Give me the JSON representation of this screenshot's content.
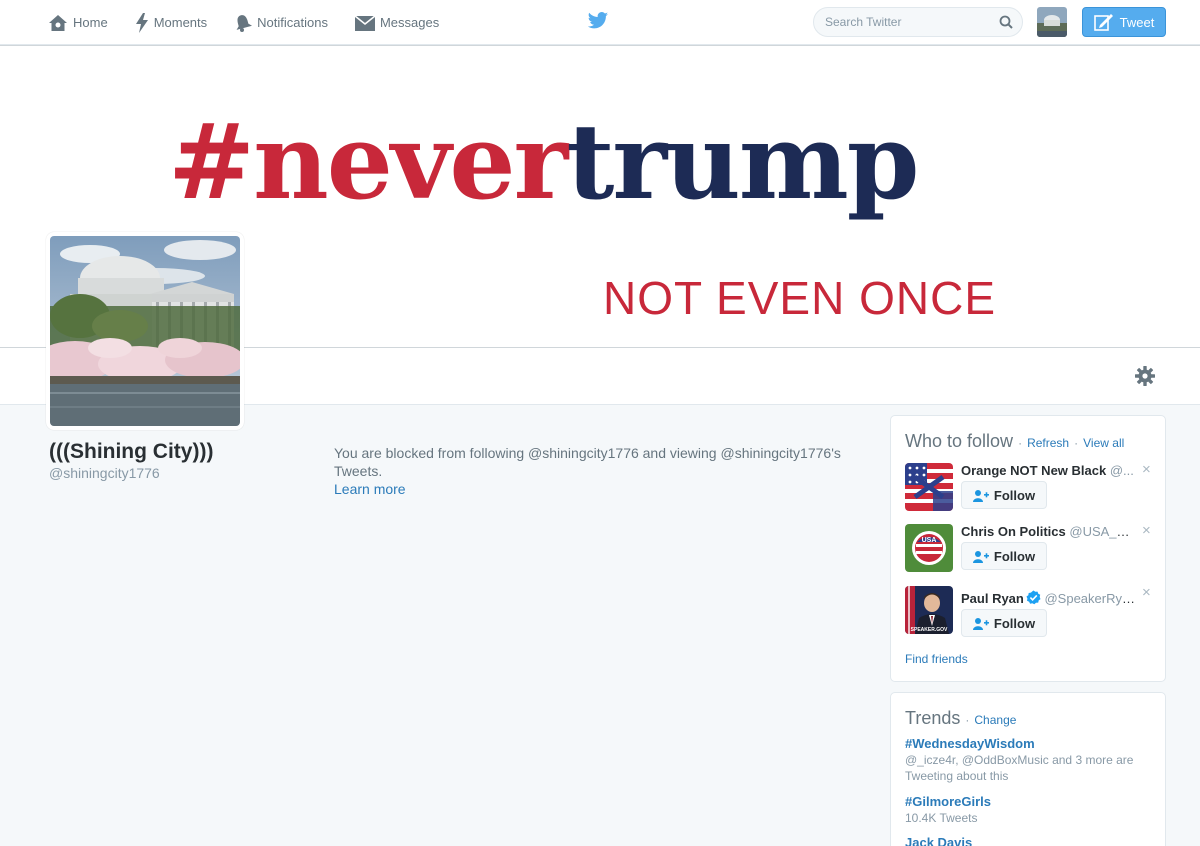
{
  "nav": {
    "items": [
      {
        "label": "Home",
        "icon": "home-icon"
      },
      {
        "label": "Moments",
        "icon": "lightning-icon"
      },
      {
        "label": "Notifications",
        "icon": "bell-icon"
      },
      {
        "label": "Messages",
        "icon": "envelope-icon"
      }
    ],
    "search_placeholder": "Search Twitter",
    "tweet_label": "Tweet"
  },
  "banner": {
    "hash": "#",
    "never": "never",
    "trump": "trump",
    "tagline": "NOT EVEN ONCE"
  },
  "profile": {
    "name": "(((Shining City)))",
    "handle": "@shiningcity1776",
    "blocked_text": "You are blocked from following @shiningcity1776 and viewing @shiningcity1776's Tweets.",
    "learn_more": "Learn more"
  },
  "who_to_follow": {
    "title": "Who to follow",
    "refresh": "Refresh",
    "view_all": "View all",
    "separator": "·",
    "follow_label": "Follow",
    "dismiss": "×",
    "suggestions": [
      {
        "name": "Orange NOT New Black",
        "handle": "@..."
      },
      {
        "name": "Chris On Politics",
        "handle": "@USA_Fi..."
      },
      {
        "name": "Paul Ryan",
        "handle": "@SpeakerRyan",
        "verified": true,
        "photo_caption": "SPEAKER.GOV"
      }
    ],
    "find_friends": "Find friends"
  },
  "trends": {
    "title": "Trends",
    "change": "Change",
    "separator": "·",
    "items": [
      {
        "name": "#WednesdayWisdom",
        "desc": "@_icze4r, @OddBoxMusic and 3 more are Tweeting about this"
      },
      {
        "name": "#GilmoreGirls",
        "desc": "10.4K Tweets"
      },
      {
        "name": "Jack Davis",
        "desc": ""
      }
    ]
  },
  "colors": {
    "accent": "#55acee",
    "link": "#2b7bb9",
    "banner_red": "#c8283a",
    "banner_navy": "#1d2b55"
  }
}
